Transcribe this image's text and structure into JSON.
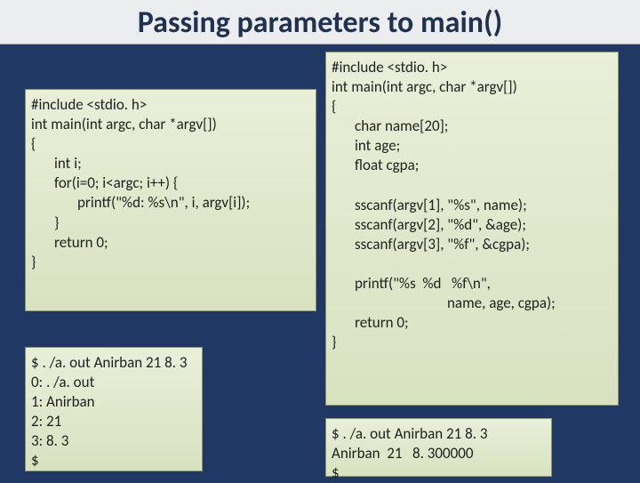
{
  "title": "Passing parameters to main()",
  "left_code": {
    "l1": "#include <stdio. h>",
    "l2": "int main(int argc, char *argv[])",
    "l3": "{",
    "l4": "int i;",
    "l5": "for(i=0; i<argc; i++) {",
    "l6": "printf(\"%d: %s\\n\", i, argv[i]);",
    "l7": "}",
    "l8": "return 0;",
    "l9": "}"
  },
  "left_out": {
    "l1": "$ . /a. out Anirban 21 8. 3",
    "l2": "0: . /a. out",
    "l3": "1: Anirban",
    "l4": "2: 21",
    "l5": "3: 8. 3",
    "l6": "$"
  },
  "right_code": {
    "l1": "#include <stdio. h>",
    "l2": "int main(int argc, char *argv[])",
    "l3": "{",
    "l4": "char name[20];",
    "l5": "int age;",
    "l6": "float cgpa;",
    "blank1": " ",
    "l7": "sscanf(argv[1], \"%s\", name);",
    "l8": "sscanf(argv[2], \"%d\", &age);",
    "l9": "sscanf(argv[3], \"%f\", &cgpa);",
    "blank2": " ",
    "l10": "printf(\"%s  %d   %f\\n\",",
    "l11": "name, age, cgpa);",
    "l12": "return 0;",
    "l13": "}"
  },
  "right_out": {
    "l1": "$ . /a. out Anirban 21 8. 3",
    "l2": "Anirban  21   8. 300000",
    "l3": "$"
  }
}
